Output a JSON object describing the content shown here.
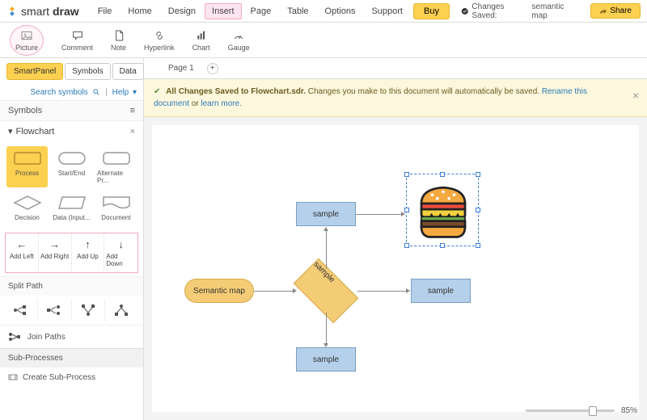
{
  "brand": {
    "name_light": "smart",
    "name_bold": "draw"
  },
  "menu": [
    "File",
    "Home",
    "Design",
    "Insert",
    "Page",
    "Table",
    "Options",
    "Support"
  ],
  "menu_highlight_index": 3,
  "buy_label": "Buy",
  "save_status_prefix": "Changes Saved:",
  "save_status_name": "semantic map",
  "share_label": "Share",
  "ribbon": [
    {
      "label": "Picture",
      "icon": "picture-icon",
      "selected": true
    },
    {
      "label": "Comment",
      "icon": "comment-icon"
    },
    {
      "label": "Note",
      "icon": "note-icon"
    },
    {
      "label": "Hyperlink",
      "icon": "hyperlink-icon"
    },
    {
      "label": "Chart",
      "icon": "chart-icon"
    },
    {
      "label": "Gauge",
      "icon": "gauge-icon"
    }
  ],
  "side_tabs": [
    {
      "label": "SmartPanel",
      "active": true
    },
    {
      "label": "Symbols"
    },
    {
      "label": "Data"
    }
  ],
  "search_link": "Search symbols",
  "help_link": "Help",
  "symbols_head": "Symbols",
  "flowchart_label": "Flowchart",
  "shapes": [
    {
      "label": "Process",
      "selected": true
    },
    {
      "label": "Start/End"
    },
    {
      "label": "Alternate Pr..."
    },
    {
      "label": "Decision"
    },
    {
      "label": "Data (Input..."
    },
    {
      "label": "Document"
    }
  ],
  "add": [
    {
      "label": "Add Left",
      "dir": "left"
    },
    {
      "label": "Add Right",
      "dir": "right"
    },
    {
      "label": "Add Up",
      "dir": "up"
    },
    {
      "label": "Add Down",
      "dir": "down"
    }
  ],
  "split_head": "Split Path",
  "join_label": "Join Paths",
  "sub_head": "Sub-Processes",
  "create_sub": "Create Sub-Process",
  "page_tab": "Page 1",
  "banner": {
    "bold": "All Changes Saved to Flowchart.sdr.",
    "text": " Changes you make to this document will automatically be saved. ",
    "rename": "Rename this document",
    "or": " or ",
    "learn": "learn more",
    "dot": "."
  },
  "nodes": {
    "start": "Semantic map",
    "top": "sample",
    "center": "sample",
    "right": "sample",
    "bottom": "sample"
  },
  "zoom": "85%"
}
